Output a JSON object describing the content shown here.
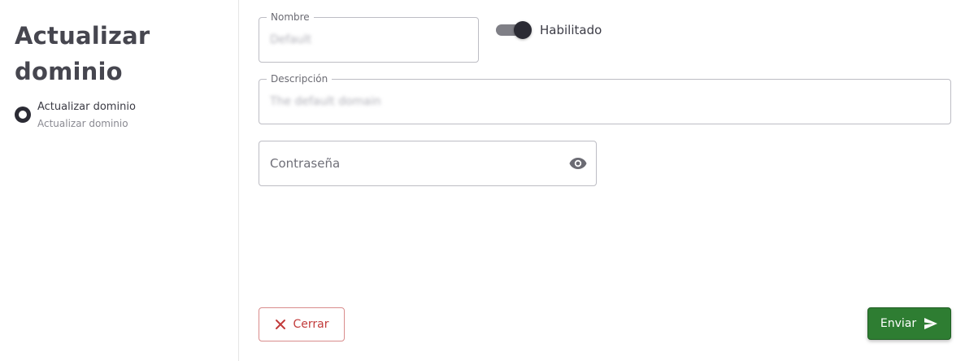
{
  "sidebar": {
    "title_line1": "Actualizar",
    "title_line2": "dominio",
    "step": {
      "label": "Actualizar dominio",
      "sublabel": "Actualizar dominio"
    }
  },
  "form": {
    "nombre": {
      "label": "Nombre",
      "value": "Default"
    },
    "enabled": {
      "label": "Habilitado",
      "checked": true
    },
    "descripcion": {
      "label": "Descripción",
      "value": "The default domain"
    },
    "password": {
      "placeholder": "Contraseña",
      "icon": "eye-icon"
    }
  },
  "actions": {
    "close_label": "Cerrar",
    "close_icon": "close-icon",
    "send_label": "Enviar",
    "send_icon": "send-icon"
  },
  "colors": {
    "primary_dark": "#2b2b34",
    "send_green": "#2e7d32",
    "close_red": "#c23b3b"
  }
}
